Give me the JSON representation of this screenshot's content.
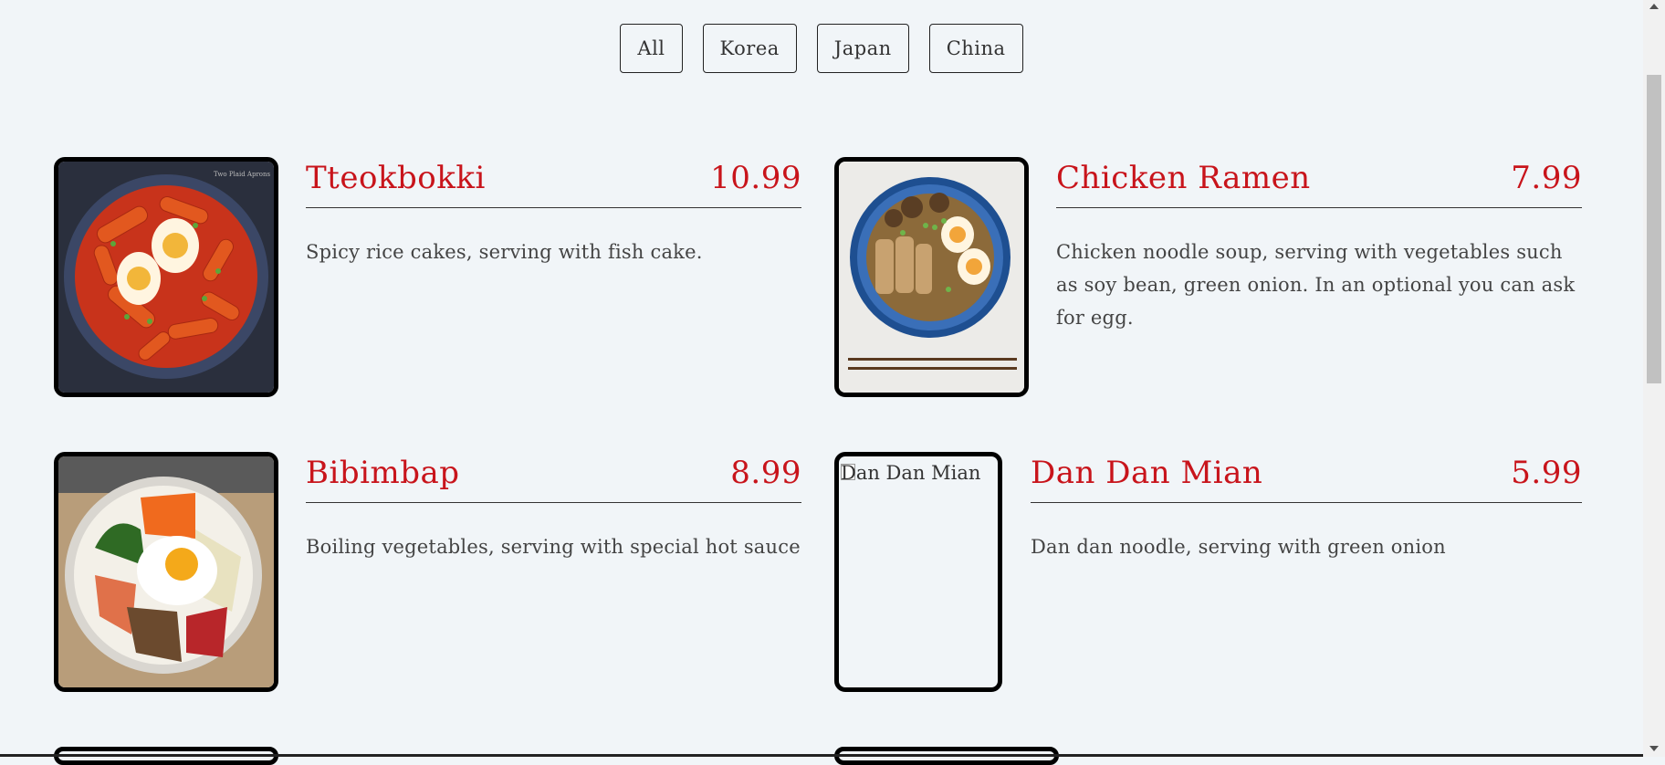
{
  "filters": [
    "All",
    "Korea",
    "Japan",
    "China"
  ],
  "menu": [
    {
      "title": "Tteokbokki",
      "price": "10.99",
      "desc": "Spicy rice cakes, serving with fish cake.",
      "image_alt": "Tteokbokki",
      "watermark": "Two Plaid Aprons"
    },
    {
      "title": "Chicken Ramen",
      "price": "7.99",
      "desc": "Chicken noodle soup, serving with vegetables such as soy bean, green onion. In an optional you can ask for egg.",
      "image_alt": "Chicken Ramen"
    },
    {
      "title": "Bibimbap",
      "price": "8.99",
      "desc": "Boiling vegetables, serving with special hot sauce",
      "image_alt": "Bibimbap"
    },
    {
      "title": "Dan Dan Mian",
      "price": "5.99",
      "desc": "Dan dan noodle, serving with green onion",
      "image_alt": "Dan Dan Mian"
    }
  ],
  "colors": {
    "accent": "#c8141b",
    "background": "#f1f5f8",
    "border": "#000000"
  }
}
